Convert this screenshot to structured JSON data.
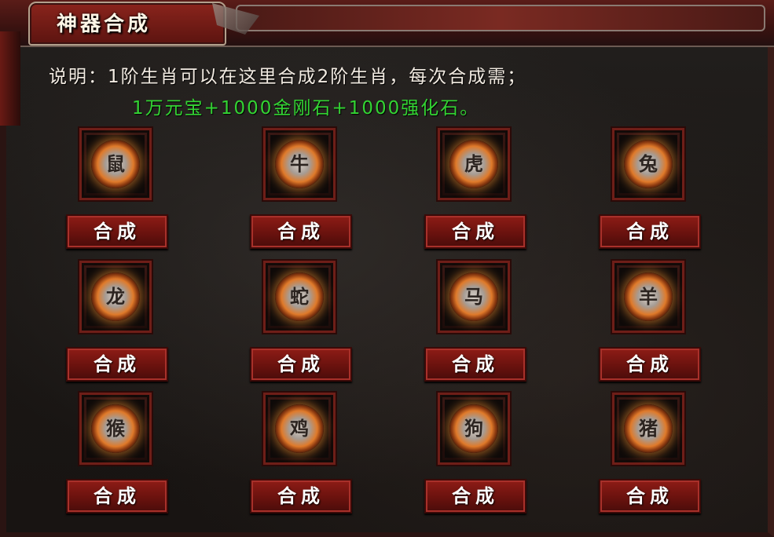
{
  "window": {
    "title": "神器合成"
  },
  "description": {
    "line1": "说明：1阶生肖可以在这里合成2阶生肖，每次合成需；",
    "line2": "1万元宝+1000金刚石+1000强化石。"
  },
  "slots": [
    {
      "icon": "rat-zodiac-icon",
      "glyph": "鼠",
      "button_label": "合成"
    },
    {
      "icon": "ox-zodiac-icon",
      "glyph": "牛",
      "button_label": "合成"
    },
    {
      "icon": "tiger-zodiac-icon",
      "glyph": "虎",
      "button_label": "合成"
    },
    {
      "icon": "rabbit-zodiac-icon",
      "glyph": "兔",
      "button_label": "合成"
    },
    {
      "icon": "dragon-zodiac-icon",
      "glyph": "龙",
      "button_label": "合成"
    },
    {
      "icon": "snake-zodiac-icon",
      "glyph": "蛇",
      "button_label": "合成"
    },
    {
      "icon": "horse-zodiac-icon",
      "glyph": "马",
      "button_label": "合成"
    },
    {
      "icon": "goat-zodiac-icon",
      "glyph": "羊",
      "button_label": "合成"
    },
    {
      "icon": "monkey-zodiac-icon",
      "glyph": "猴",
      "button_label": "合成"
    },
    {
      "icon": "rooster-zodiac-icon",
      "glyph": "鸡",
      "button_label": "合成"
    },
    {
      "icon": "dog-zodiac-icon",
      "glyph": "狗",
      "button_label": "合成"
    },
    {
      "icon": "pig-zodiac-icon",
      "glyph": "猪",
      "button_label": "合成"
    }
  ],
  "colors": {
    "cost_text": "#33d433",
    "button": "#8e1c16",
    "title_tab": "#8a241c"
  }
}
